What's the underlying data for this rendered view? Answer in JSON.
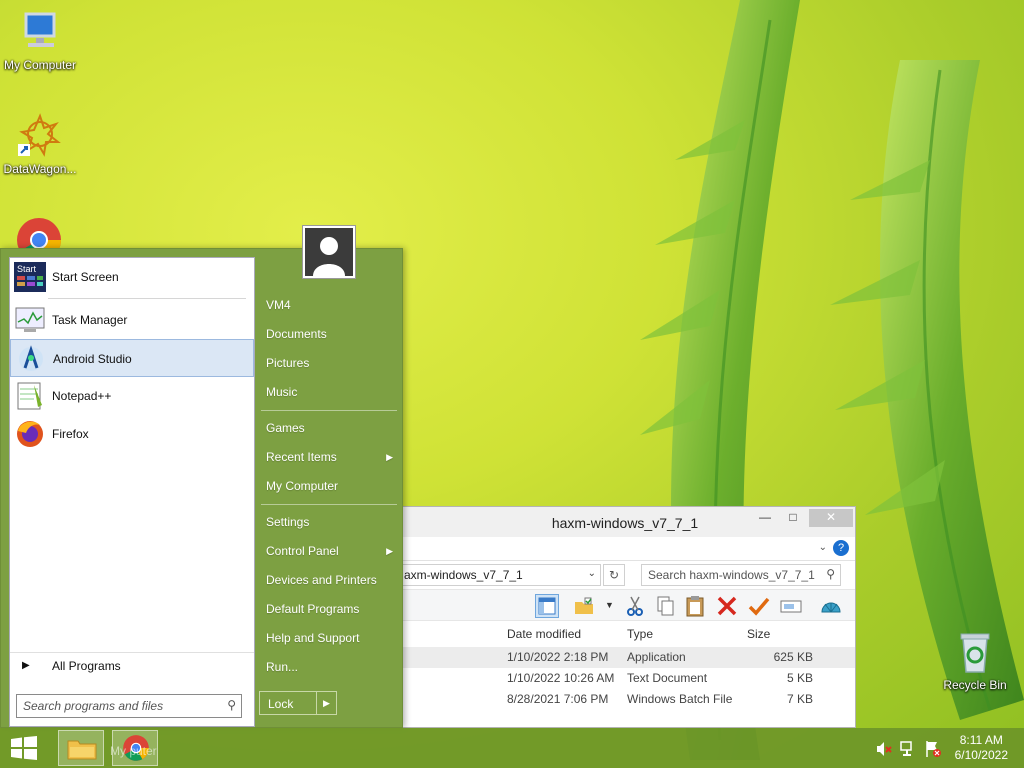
{
  "desktop": {
    "icons": [
      {
        "label": "My Computer"
      },
      {
        "label": "DataWagon..."
      },
      {
        "label": "Recycle Bin"
      }
    ]
  },
  "explorer": {
    "title": "haxm-windows_v7_7_1",
    "address": "axm-windows_v7_7_1",
    "search_placeholder": "Search haxm-windows_v7_7_1",
    "columns": [
      "Date modified",
      "Type",
      "Size"
    ],
    "rows": [
      {
        "date": "1/10/2022 2:18 PM",
        "type": "Application",
        "size": "625 KB"
      },
      {
        "date": "1/10/2022 10:26 AM",
        "type": "Text Document",
        "size": "5 KB"
      },
      {
        "date": "8/28/2021 7:06 PM",
        "type": "Windows Batch File",
        "size": "7 KB"
      }
    ]
  },
  "start_menu": {
    "pinned": [
      {
        "label": "Start Screen",
        "icon_text": "Start"
      },
      {
        "label": "Task Manager"
      },
      {
        "label": "Android Studio"
      },
      {
        "label": "Notepad++"
      },
      {
        "label": "Firefox"
      }
    ],
    "all_programs": "All Programs",
    "search_placeholder": "Search programs and files",
    "right_items": [
      {
        "label": "VM4"
      },
      {
        "label": "Documents"
      },
      {
        "label": "Pictures"
      },
      {
        "label": "Music"
      },
      {
        "label": "Games"
      },
      {
        "label": "Recent Items"
      },
      {
        "label": "My Computer"
      },
      {
        "label": "Settings"
      },
      {
        "label": "Control Panel"
      },
      {
        "label": "Devices and Printers"
      },
      {
        "label": "Default Programs"
      },
      {
        "label": "Help and Support"
      },
      {
        "label": "Run..."
      }
    ],
    "lock": "Lock"
  },
  "taskbar": {
    "ghost_text": "My   puter",
    "time": "8:11 AM",
    "date": "6/10/2022"
  },
  "colors": {
    "start_menu_bg": "#7da042",
    "taskbar_bg": "#6e9628",
    "selection": "#dbe7f5"
  }
}
